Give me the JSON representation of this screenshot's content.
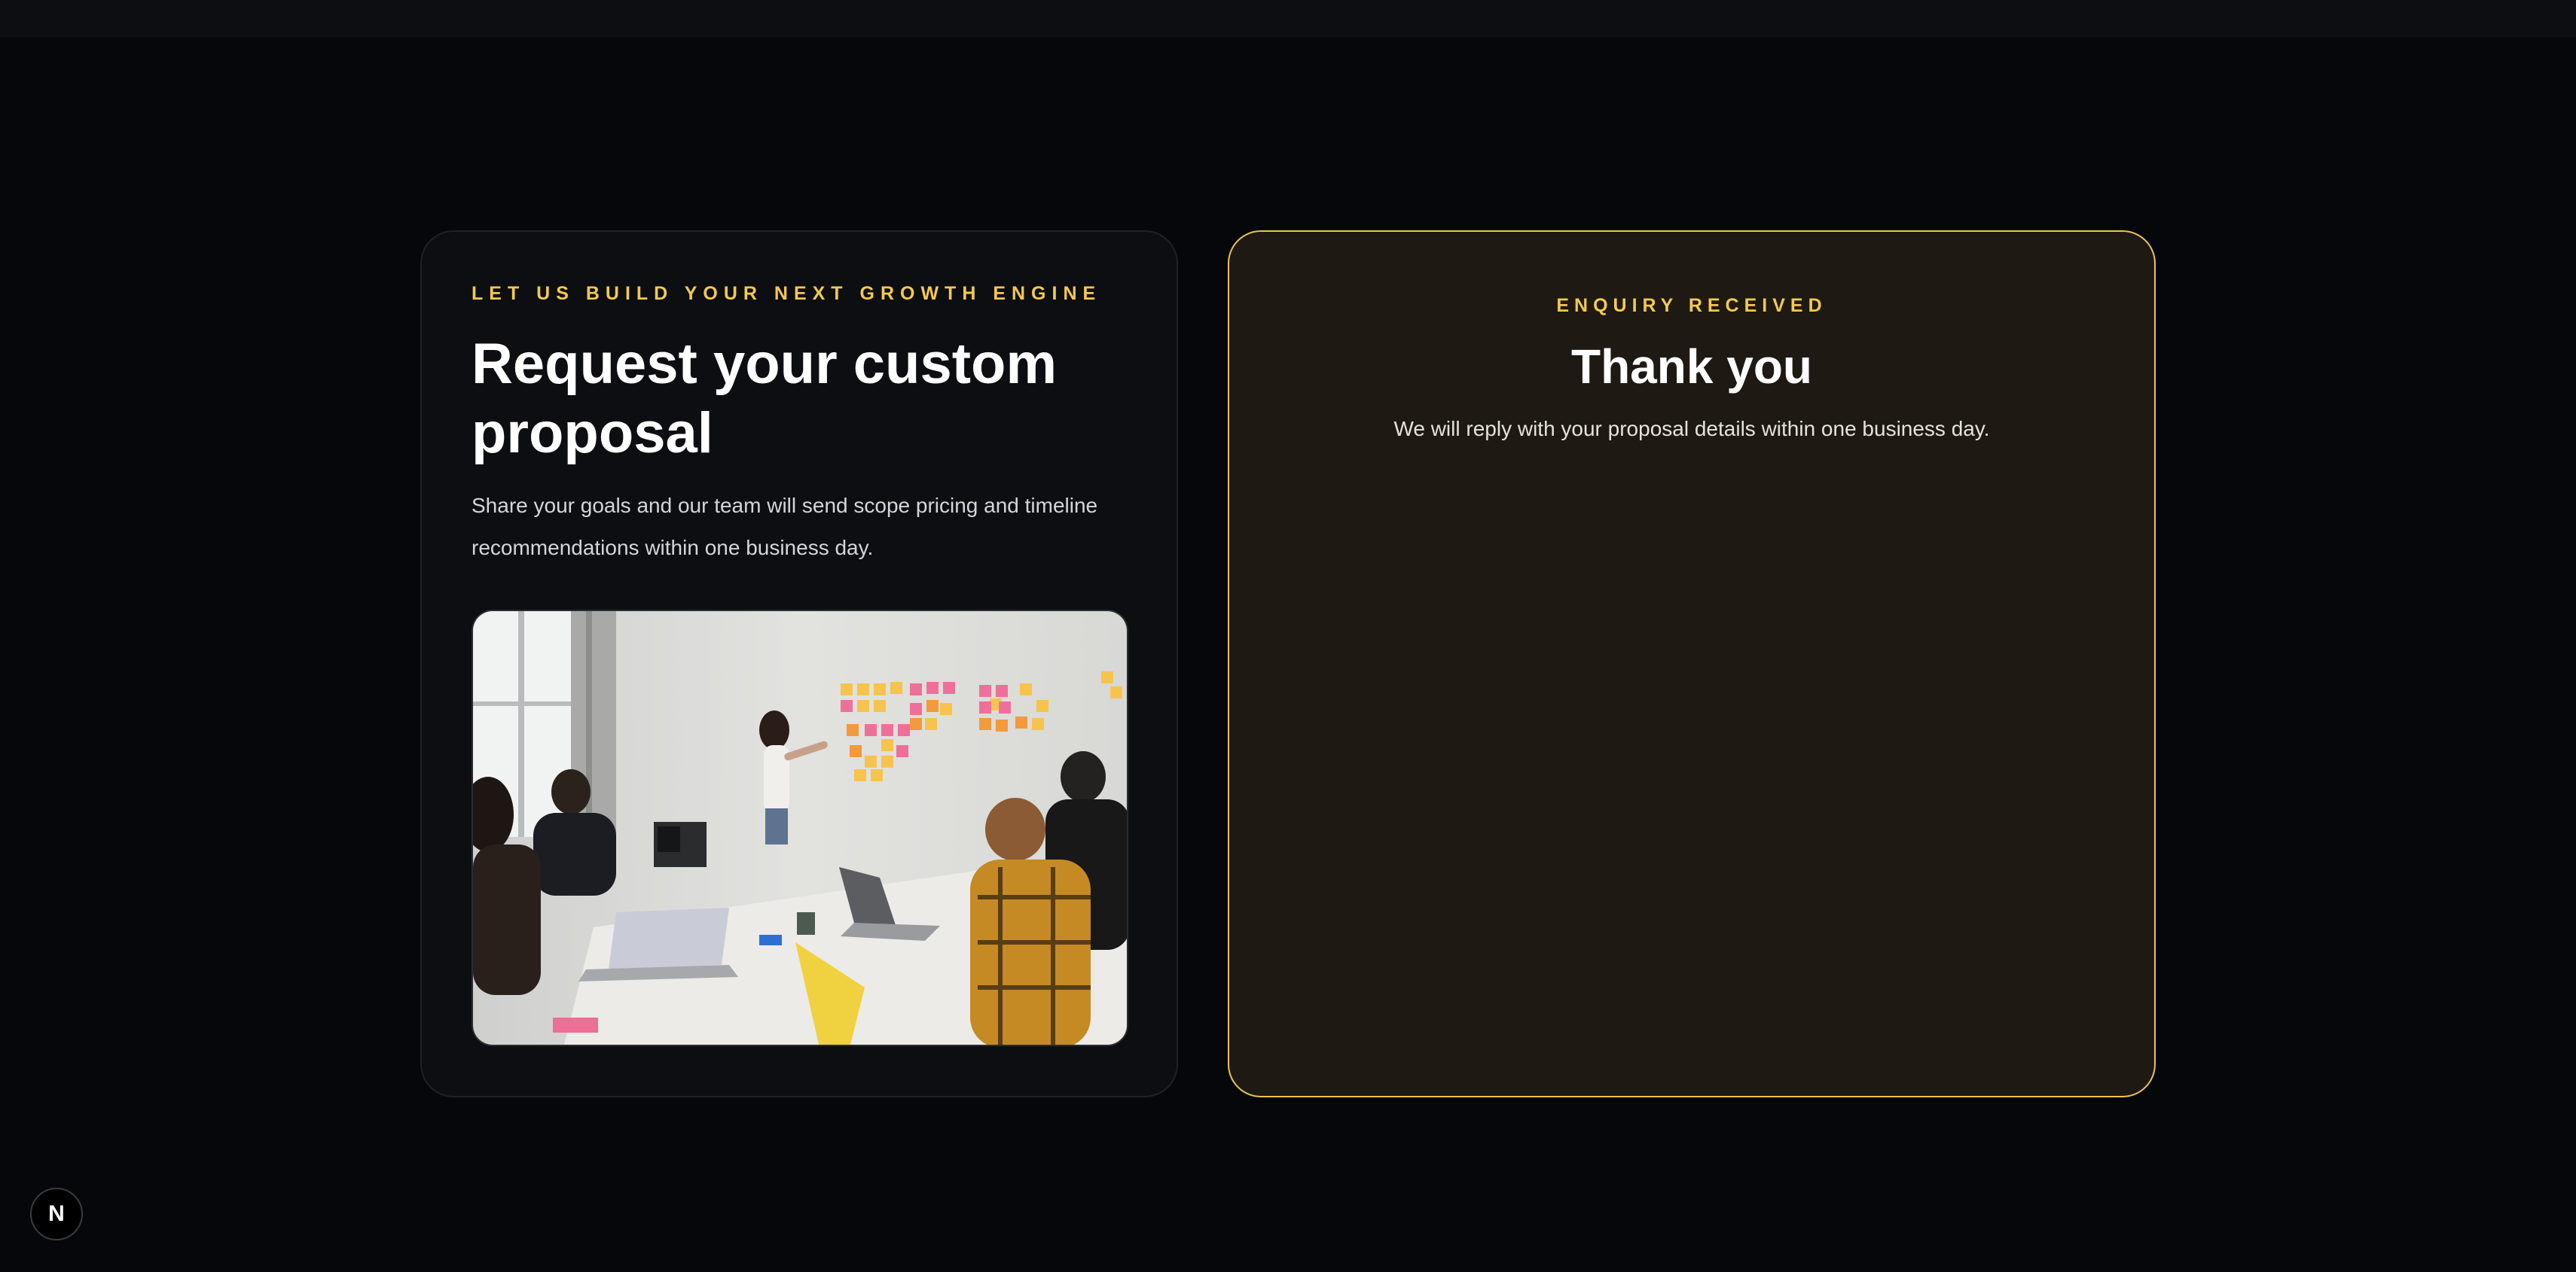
{
  "proposal": {
    "eyebrow": "LET US BUILD YOUR NEXT GROWTH ENGINE",
    "title": "Request your custom proposal",
    "description": "Share your goals and our team will send scope pricing and timeline recommendations within one business day.",
    "image_alt": "Team meeting with sticky notes on a wall"
  },
  "confirmation": {
    "eyebrow": "ENQUIRY RECEIVED",
    "title": "Thank you",
    "message": "We will reply with your proposal details within one business day."
  },
  "dev_indicator": {
    "label": "N",
    "icon": "next-logo-icon"
  },
  "colors": {
    "accent": "#f3c94f",
    "background": "#06070b",
    "card": "#0d0e12",
    "confirmation_card": "#1e1a13"
  }
}
